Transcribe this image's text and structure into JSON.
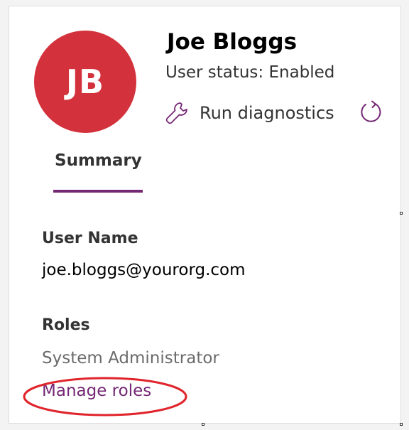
{
  "profile": {
    "initials": "JB",
    "name": "Joe Bloggs",
    "status": "User status: Enabled",
    "avatar_color": "#d3323c"
  },
  "actions": {
    "run_diagnostics_label": "Run diagnostics",
    "wrench_icon": "wrench-icon",
    "refresh_icon": "refresh-icon"
  },
  "tabs": [
    {
      "label": "Summary",
      "active": true
    }
  ],
  "fields": {
    "user_name_label": "User Name",
    "user_name_value": "joe.bloggs@yourorg.com",
    "roles_label": "Roles",
    "roles_value": "System Administrator",
    "manage_roles_link": "Manage roles"
  },
  "colors": {
    "accent": "#742774",
    "annotation": "#e0242c"
  }
}
